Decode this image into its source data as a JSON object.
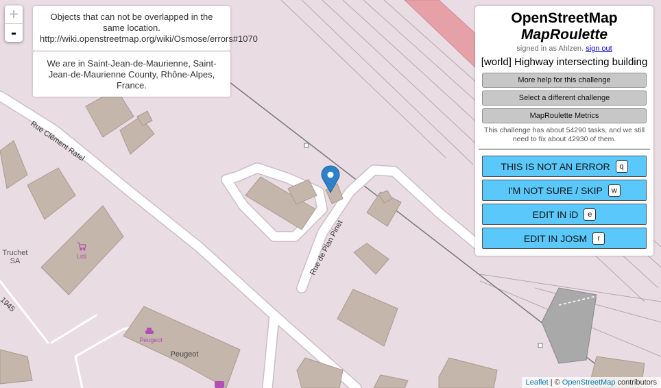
{
  "zoom": {
    "in": "+",
    "out": "-"
  },
  "info": {
    "error_text": "Objects that can not be overlapped in the same location. http://wiki.openstreetmap.org/wiki/Osmose/errors#1070",
    "location_text": "We are in Saint-Jean-de-Maurienne, Saint-Jean-de-Maurienne County, Rhône-Alpes, France."
  },
  "panel": {
    "title_line1": "OpenStreetMap",
    "title_line2": "MapRoulette",
    "signed_in_text": "signed in as Ahlzen.",
    "sign_out": "sign out",
    "challenge": "[world] Highway intersecting building",
    "help_button": "More help for this challenge",
    "select_button": "Select a different challenge",
    "metrics_button": "MapRoulette Metrics",
    "stats": "This challenge has about 54290 tasks, and we still need to fix about 42930 of them.",
    "actions": [
      {
        "label": "THIS IS NOT AN ERROR",
        "key": "q"
      },
      {
        "label": "I'M NOT SURE / SKIP",
        "key": "w"
      },
      {
        "label": "EDIT IN iD",
        "key": "e"
      },
      {
        "label": "EDIT IN JOSM",
        "key": "r"
      }
    ]
  },
  "map": {
    "streets": [
      "Rue Clément Ratel",
      "Rue de Plan Pinet"
    ],
    "pois": [
      "Truchet SA",
      "Lidl",
      "Peugeot",
      "Peugeot"
    ],
    "road_number": "1945"
  },
  "attribution": {
    "leaflet": "Leaflet",
    "sep": "| ©",
    "osm": "OpenStreetMap",
    "rest": "contributors"
  }
}
